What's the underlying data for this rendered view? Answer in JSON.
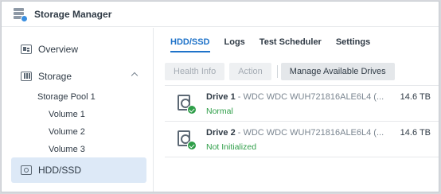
{
  "window": {
    "title": "Storage Manager",
    "app_icon": "storage-manager-icon"
  },
  "sidebar": {
    "items": [
      {
        "label": "Overview",
        "icon": "overview-icon"
      },
      {
        "label": "Storage",
        "icon": "storage-icon",
        "expanded": true
      },
      {
        "label": "HDD/SSD",
        "icon": "hdd-icon",
        "active": true
      }
    ],
    "storage_children": [
      {
        "label": "Storage Pool 1"
      },
      {
        "label": "Volume 1"
      },
      {
        "label": "Volume 2"
      },
      {
        "label": "Volume 3"
      }
    ]
  },
  "tabs": [
    {
      "label": "HDD/SSD",
      "active": true
    },
    {
      "label": "Logs"
    },
    {
      "label": "Test Scheduler"
    },
    {
      "label": "Settings"
    }
  ],
  "toolbar": {
    "health_info": "Health Info",
    "action": "Action",
    "manage": "Manage Available Drives"
  },
  "drives": [
    {
      "name": "Drive 1",
      "model": " - WDC WDC WUH721816ALE6L4 (...",
      "size": "14.6 TB",
      "status": "Normal"
    },
    {
      "name": "Drive 2",
      "model": " - WDC WDC WUH721816ALE6L4 (...",
      "size": "14.6 TB",
      "status": "Not Initialized"
    }
  ],
  "colors": {
    "accent": "#1f73c9",
    "status_ok": "#2e9e48",
    "active_bg": "#dde9f7"
  }
}
